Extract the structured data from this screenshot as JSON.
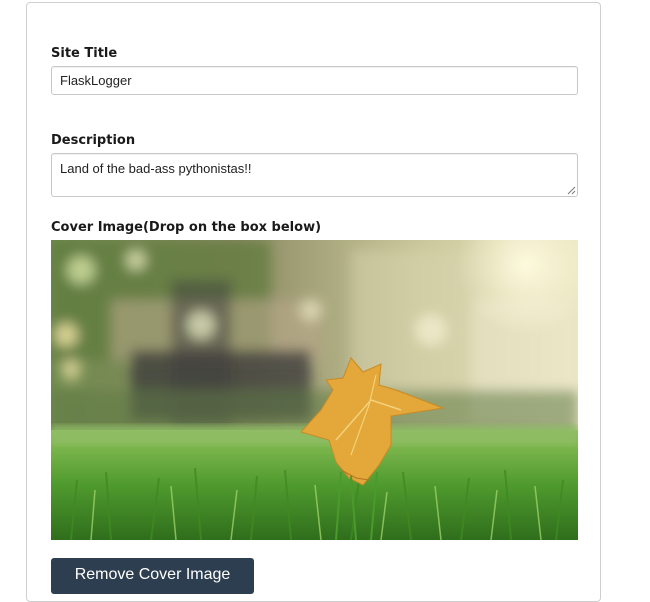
{
  "form": {
    "site_title": {
      "label": "Site Title",
      "value": "FlaskLogger"
    },
    "description": {
      "label": "Description",
      "value": "Land of the bad-ass pythonistas!!"
    },
    "cover_image": {
      "label": "Cover Image(Drop on the box below)",
      "image_subject": "autumn leaf on grass photo"
    },
    "remove_button": {
      "label": "Remove Cover Image"
    }
  },
  "colors": {
    "button_bg": "#2c3e50",
    "button_text": "#ffffff",
    "border": "#c8c8c8",
    "label_text": "#1a1a1a"
  }
}
